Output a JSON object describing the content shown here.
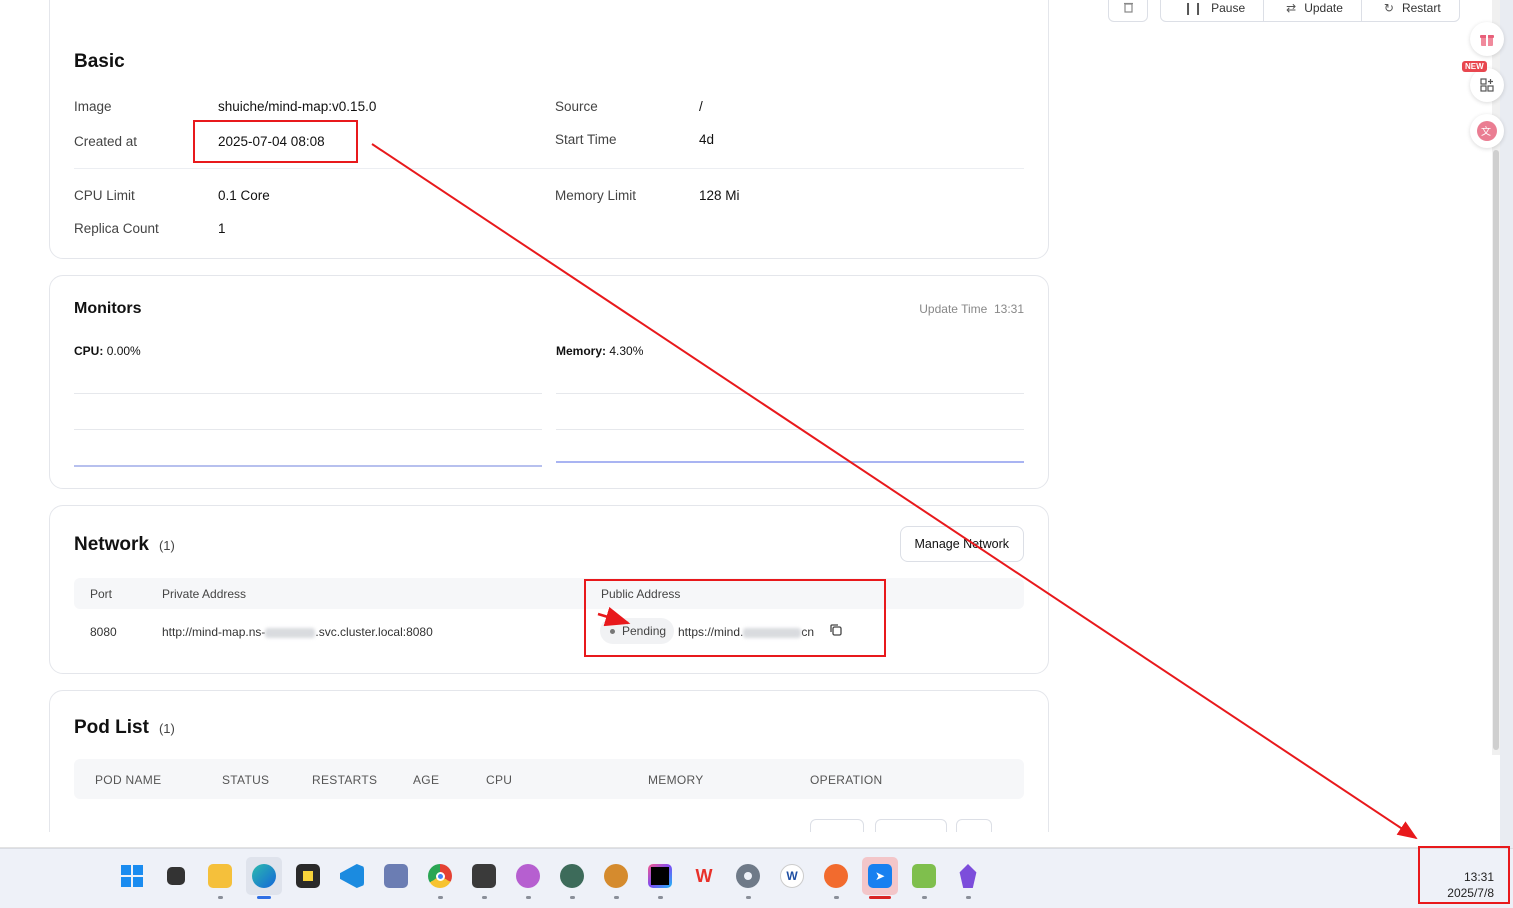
{
  "toolbar": {
    "delete_icon": "trash-icon",
    "pause_label": "Pause",
    "update_label": "Update",
    "restart_label": "Restart"
  },
  "basic": {
    "title": "Basic",
    "image_label": "Image",
    "image_value": "shuiche/mind-map:v0.15.0",
    "source_label": "Source",
    "source_value": "/",
    "created_label": "Created at",
    "created_value": "2025-07-04 08:08",
    "start_label": "Start Time",
    "start_value": "4d",
    "cpu_limit_label": "CPU Limit",
    "cpu_limit_value": "0.1 Core",
    "memory_limit_label": "Memory Limit",
    "memory_limit_value": "128 Mi",
    "replica_label": "Replica Count",
    "replica_value": "1"
  },
  "monitors": {
    "title": "Monitors",
    "update_time_label": "Update Time",
    "update_time_value": "13:31",
    "cpu_label": "CPU:",
    "cpu_value": "0.00%",
    "memory_label": "Memory:",
    "memory_value": "4.30%"
  },
  "network": {
    "title": "Network",
    "count": "(1)",
    "manage_button": "Manage Network",
    "columns": [
      "Port",
      "Private Address",
      "Public Address"
    ],
    "row": {
      "port": "8080",
      "private_prefix": "http://mind-map.ns-",
      "private_suffix": ".svc.cluster.local:8080",
      "status": "Pending",
      "public_prefix": "https://mind.",
      "public_suffix": "cn"
    }
  },
  "pods": {
    "title": "Pod List",
    "count": "(1)",
    "columns": [
      "POD NAME",
      "STATUS",
      "RESTARTS",
      "AGE",
      "CPU",
      "MEMORY",
      "OPERATION"
    ]
  },
  "taskbar": {
    "apps": [
      "windows-start",
      "task-view",
      "file-explorer",
      "edge",
      "sticky-notes",
      "vscode",
      "screen-tool",
      "chrome",
      "terminal-app",
      "cat-app",
      "panda-app",
      "dog-app",
      "intellij",
      "wps",
      "settings",
      "word-app",
      "paw-app",
      "feishu-app",
      "notepad-app",
      "obsidian"
    ],
    "time": "13:31",
    "date": "2025/7/8"
  },
  "colors": {
    "annotation": "#e8191c",
    "accent": "#2f6fe4"
  }
}
